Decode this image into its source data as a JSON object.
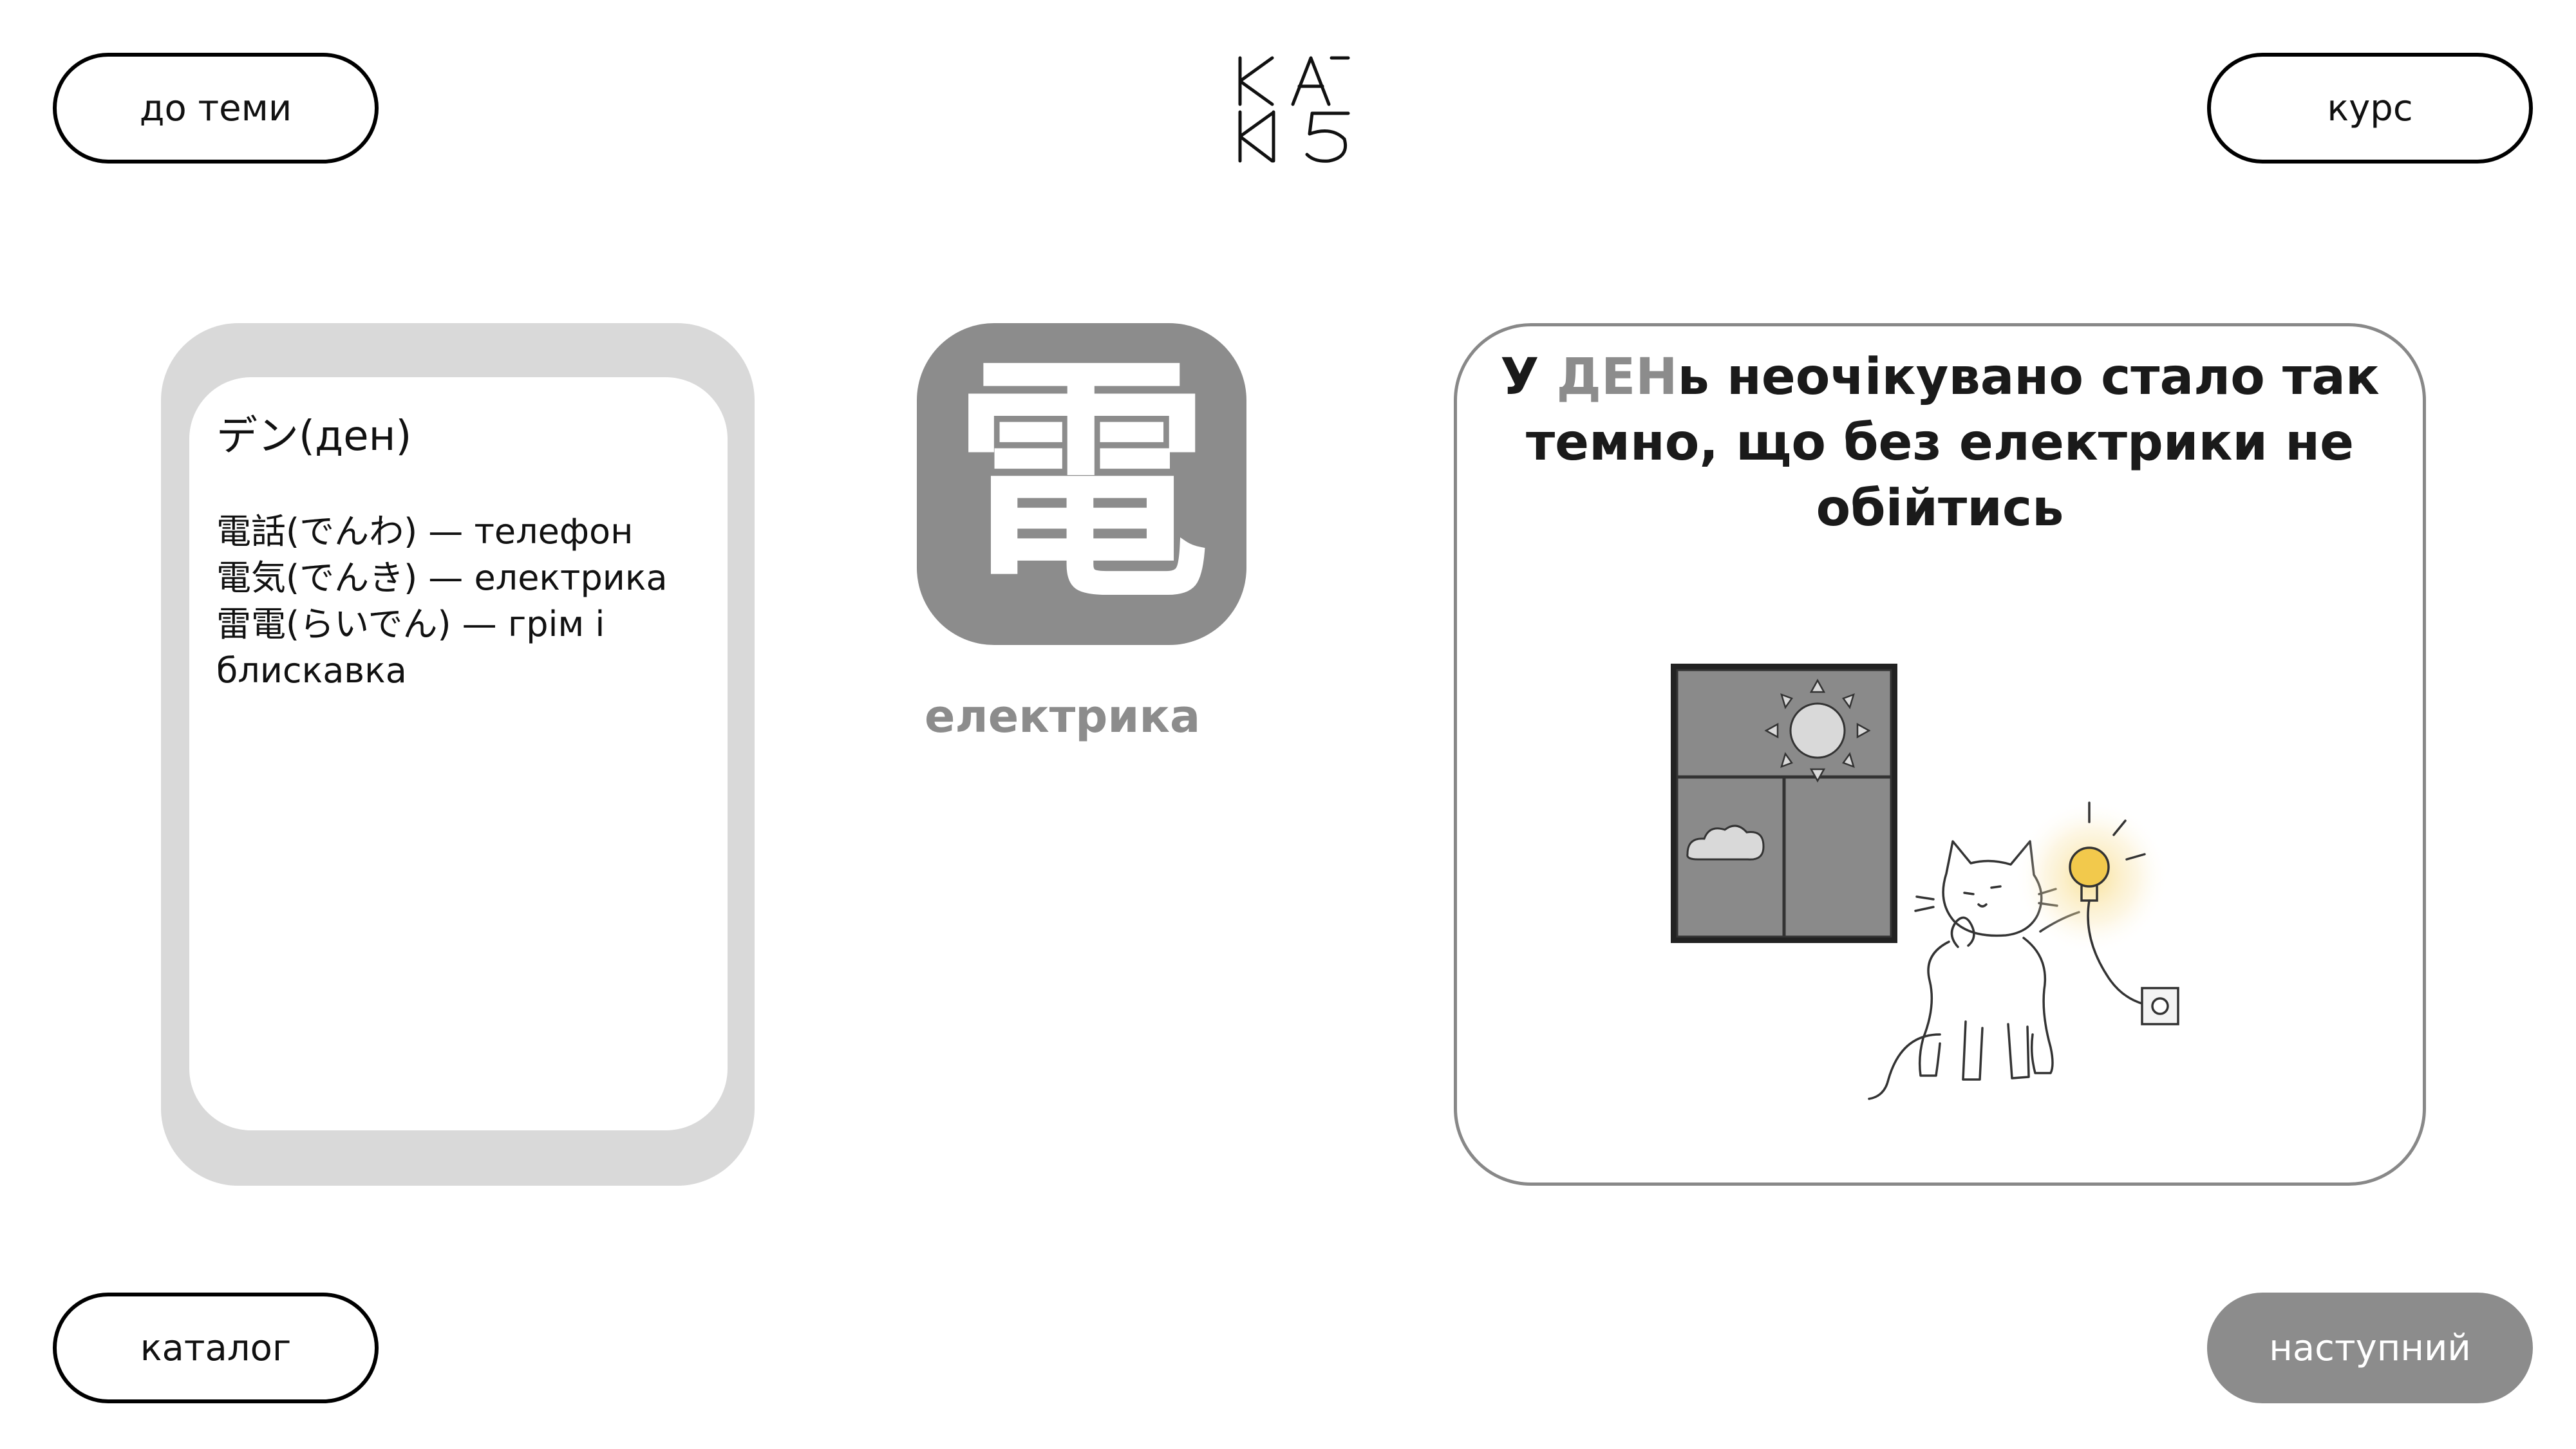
{
  "nav": {
    "back_label": "до теми",
    "course_label": "курс",
    "catalog_label": "каталог",
    "next_label": "наступний"
  },
  "reading_card": {
    "reading": "デン(ден)",
    "words": [
      "電話(でんわ) — телефон",
      "電気(でんき) — електрика",
      "雷電(らいでん) — грім і",
      "блискавка"
    ]
  },
  "kanji": {
    "character": "電",
    "meaning": "електрика"
  },
  "story": {
    "prefix": "У ",
    "highlight": "ДЕН",
    "suffix": "ь неочікувано стало так темно, що без електрики не обійтись"
  },
  "colors": {
    "accent": "#8c8c8c",
    "card_border": "#d9d9d9",
    "text": "#111111"
  }
}
